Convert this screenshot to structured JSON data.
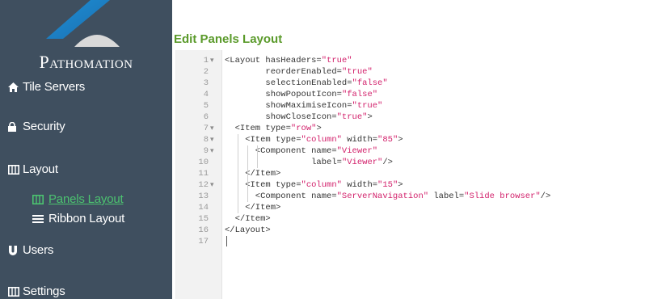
{
  "sidebar": {
    "brand": "Pathomation",
    "items": [
      {
        "key": "tile-servers",
        "icon": "home-icon",
        "label": "Tile Servers"
      },
      {
        "key": "security",
        "icon": "lock-icon",
        "label": "Security"
      },
      {
        "key": "layout",
        "icon": "columns-icon",
        "label": "Layout"
      },
      {
        "key": "panels-layout",
        "icon": "columns-icon",
        "label": "Panels Layout",
        "active": true
      },
      {
        "key": "ribbon-layout",
        "icon": "bars-icon",
        "label": "Ribbon Layout"
      },
      {
        "key": "users",
        "icon": "user-icon",
        "label": "Users"
      },
      {
        "key": "settings",
        "icon": "columns-icon",
        "label": "Settings"
      }
    ]
  },
  "main": {
    "title": "Edit Panels Layout"
  },
  "editor": {
    "lines": [
      {
        "n": "1",
        "fold": true,
        "segments": [
          {
            "t": "<Layout hasHeaders=",
            "s": false
          },
          {
            "t": "\"true\"",
            "s": true
          }
        ]
      },
      {
        "n": "2",
        "fold": false,
        "segments": [
          {
            "t": "        reorderEnabled=",
            "s": false
          },
          {
            "t": "\"true\"",
            "s": true
          }
        ]
      },
      {
        "n": "3",
        "fold": false,
        "segments": [
          {
            "t": "        selectionEnabled=",
            "s": false
          },
          {
            "t": "\"false\"",
            "s": true
          }
        ]
      },
      {
        "n": "4",
        "fold": false,
        "segments": [
          {
            "t": "        showPopoutIcon=",
            "s": false
          },
          {
            "t": "\"false\"",
            "s": true
          }
        ]
      },
      {
        "n": "5",
        "fold": false,
        "segments": [
          {
            "t": "        showMaximiseIcon=",
            "s": false
          },
          {
            "t": "\"true\"",
            "s": true
          }
        ]
      },
      {
        "n": "6",
        "fold": false,
        "segments": [
          {
            "t": "        showCloseIcon=",
            "s": false
          },
          {
            "t": "\"true\"",
            "s": true
          },
          {
            "t": ">",
            "s": false
          }
        ]
      },
      {
        "n": "7",
        "fold": true,
        "segments": [
          {
            "t": "  <Item type=",
            "s": false
          },
          {
            "t": "\"row\"",
            "s": true
          },
          {
            "t": ">",
            "s": false
          }
        ]
      },
      {
        "n": "8",
        "fold": true,
        "segments": [
          {
            "t": "    <Item type=",
            "s": false
          },
          {
            "t": "\"column\"",
            "s": true
          },
          {
            "t": " width=",
            "s": false
          },
          {
            "t": "\"85\"",
            "s": true
          },
          {
            "t": ">",
            "s": false
          }
        ]
      },
      {
        "n": "9",
        "fold": true,
        "segments": [
          {
            "t": "      <Component name=",
            "s": false
          },
          {
            "t": "\"Viewer\"",
            "s": true
          }
        ]
      },
      {
        "n": "10",
        "fold": false,
        "segments": [
          {
            "t": "                 label=",
            "s": false
          },
          {
            "t": "\"Viewer\"",
            "s": true
          },
          {
            "t": "/>",
            "s": false
          }
        ]
      },
      {
        "n": "11",
        "fold": false,
        "segments": [
          {
            "t": "    </Item>",
            "s": false
          }
        ]
      },
      {
        "n": "12",
        "fold": true,
        "segments": [
          {
            "t": "    <Item type=",
            "s": false
          },
          {
            "t": "\"column\"",
            "s": true
          },
          {
            "t": " width=",
            "s": false
          },
          {
            "t": "\"15\"",
            "s": true
          },
          {
            "t": ">",
            "s": false
          }
        ]
      },
      {
        "n": "13",
        "fold": false,
        "segments": [
          {
            "t": "      <Component name=",
            "s": false
          },
          {
            "t": "\"ServerNavigation\"",
            "s": true
          },
          {
            "t": " label=",
            "s": false
          },
          {
            "t": "\"Slide browser\"",
            "s": true
          },
          {
            "t": "/>",
            "s": false
          }
        ]
      },
      {
        "n": "14",
        "fold": false,
        "segments": [
          {
            "t": "    </Item>",
            "s": false
          }
        ]
      },
      {
        "n": "15",
        "fold": false,
        "segments": [
          {
            "t": "  </Item>",
            "s": false
          }
        ]
      },
      {
        "n": "16",
        "fold": false,
        "segments": [
          {
            "t": "</Layout>",
            "s": false
          }
        ]
      },
      {
        "n": "17",
        "fold": false,
        "segments": []
      }
    ]
  }
}
